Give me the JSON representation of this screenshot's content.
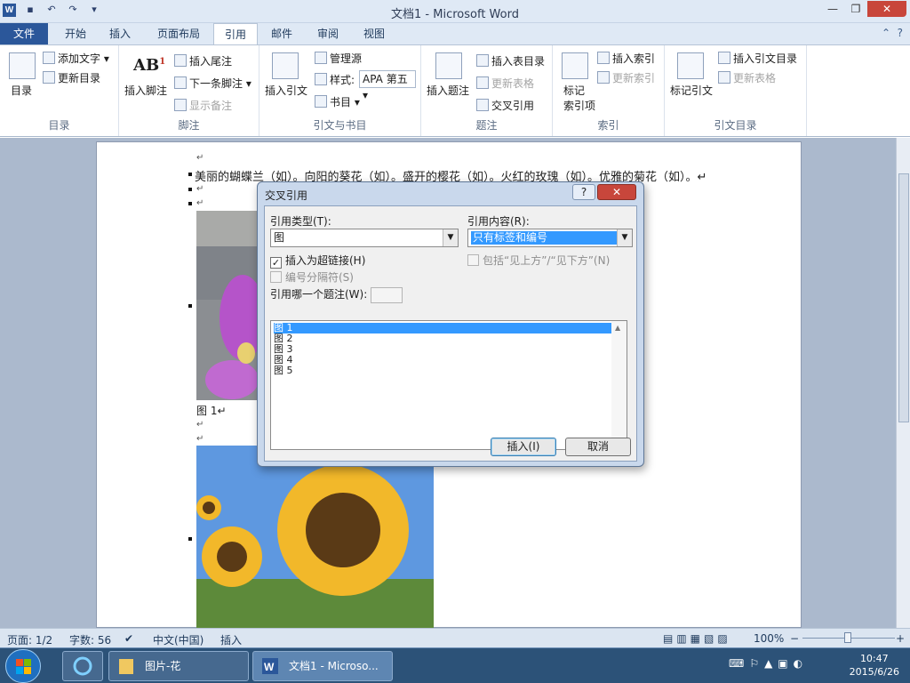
{
  "window": {
    "title": "文档1  -  Microsoft Word",
    "logo": "W",
    "minimize": "—",
    "restore": "❐",
    "close": "✕"
  },
  "menu_tabs": [
    "文件",
    "开始",
    "插入",
    "页面布局",
    "引用",
    "邮件",
    "审阅",
    "视图"
  ],
  "active_tab": "引用",
  "ribbon": {
    "toc": {
      "label": "目录",
      "big": "目录",
      "add_text": "添加文字",
      "update": "更新目录"
    },
    "footnotes": {
      "label": "脚注",
      "insert_footnote": "插入脚注",
      "insert_endnote": "插入尾注",
      "next_footnote": "下一条脚注",
      "show_notes": "显示备注"
    },
    "citations": {
      "label": "引文与书目",
      "insert_citation": "插入引文",
      "manage_sources": "管理源",
      "style_label": "样式:",
      "style_value": "APA 第五",
      "bibliography": "书目"
    },
    "captions": {
      "label": "题注",
      "insert_caption": "插入题注",
      "insert_table_of_figures": "插入表目录",
      "update_table": "更新表格",
      "cross_reference": "交叉引用"
    },
    "index": {
      "label": "索引",
      "mark_entry_1": "标记",
      "mark_entry_2": "索引项",
      "insert_index": "插入索引",
      "update_index": "更新索引"
    },
    "toa": {
      "label": "引文目录",
      "mark_citation": "标记引文",
      "insert_toa": "插入引文目录",
      "update_table": "更新表格"
    }
  },
  "document": {
    "line1": "美丽的蝴蝶兰（如）。向阳的葵花（如）。盛开的樱花（如）。火红的玫瑰（如）。优雅的菊花（如）。↵",
    "caption1": "图  1↵",
    "para_mark": "↵"
  },
  "dialog": {
    "title": "交叉引用",
    "help": "?",
    "close": "✕",
    "ref_type_label": "引用类型(T):",
    "ref_type_value": "图",
    "ref_content_label": "引用内容(R):",
    "ref_content_value": "只有标签和编号",
    "hyperlink_label": "插入为超链接(H)",
    "hyperlink_checked": true,
    "above_below_label": "包括“见上方”/“见下方”(N)",
    "separator_label": "编号分隔符(S)",
    "which_caption_label": "引用哪一个题注(W):",
    "captions": [
      "图 1",
      "图 2",
      "图 3",
      "图 4",
      "图 5"
    ],
    "selected_caption": "图 1",
    "insert_button": "插入(I)",
    "cancel_button": "取消"
  },
  "statusbar": {
    "page": "页面: 1/2",
    "words": "字数: 56",
    "language": "中文(中国)",
    "mode": "插入",
    "zoom": "100%",
    "zoom_minus": "−",
    "zoom_plus": "+"
  },
  "taskbar": {
    "folder_window": "图片-花",
    "word_window": "文档1 - Microso...",
    "time": "10:47",
    "date": "2015/6/26"
  },
  "colors": {
    "accent": "#2b579a",
    "selection": "#3399ff",
    "taskbar": "#2c5278"
  }
}
